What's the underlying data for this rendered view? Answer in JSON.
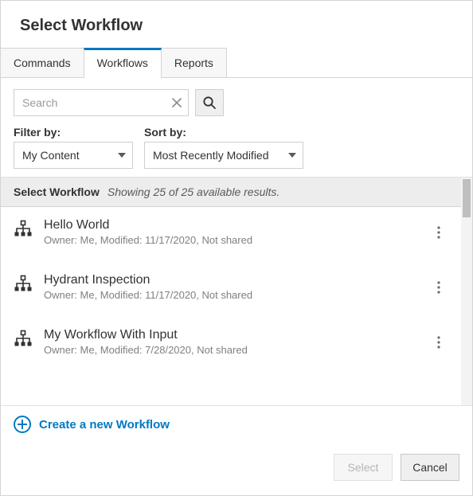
{
  "dialog": {
    "title": "Select Workflow"
  },
  "tabs": [
    {
      "label": "Commands",
      "active": false
    },
    {
      "label": "Workflows",
      "active": true
    },
    {
      "label": "Reports",
      "active": false
    }
  ],
  "search": {
    "placeholder": "Search",
    "value": ""
  },
  "filter": {
    "label": "Filter by:",
    "value": "My Content"
  },
  "sort": {
    "label": "Sort by:",
    "value": "Most Recently Modified"
  },
  "results": {
    "heading": "Select Workflow",
    "summary": "Showing 25 of 25 available results.",
    "items": [
      {
        "title": "Hello World",
        "meta": "Owner: Me, Modified: 11/17/2020, Not shared"
      },
      {
        "title": "Hydrant Inspection",
        "meta": "Owner: Me, Modified: 11/17/2020, Not shared"
      },
      {
        "title": "My Workflow With Input",
        "meta": "Owner: Me, Modified: 7/28/2020, Not shared"
      }
    ]
  },
  "createLink": {
    "label": "Create a new Workflow"
  },
  "buttons": {
    "select": "Select",
    "cancel": "Cancel"
  }
}
